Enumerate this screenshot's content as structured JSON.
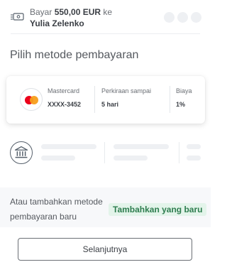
{
  "header": {
    "pay_prefix": "Bayar",
    "amount": "550,00 EUR",
    "pay_suffix": "ke",
    "recipient": "Yulia Zelenko",
    "progress_steps_shown": 3
  },
  "section_title": "Pilih metode pembayaran",
  "selected_method": {
    "brand": "Mastercard",
    "card_number": "XXXX-3452",
    "estimate_label": "Perkiraan sampai",
    "estimate_value": "5 hari",
    "fee_label": "Biaya",
    "fee_value": "1%",
    "icon": "mastercard-icon"
  },
  "bank_option": {
    "icon": "bank-icon"
  },
  "add_method": {
    "text": "Atau tambahkan metode pembayaran baru",
    "link_label": "Tambahkan yang baru",
    "link_color": "#2e7d4f"
  },
  "next_button": {
    "label": "Selanjutnya"
  }
}
